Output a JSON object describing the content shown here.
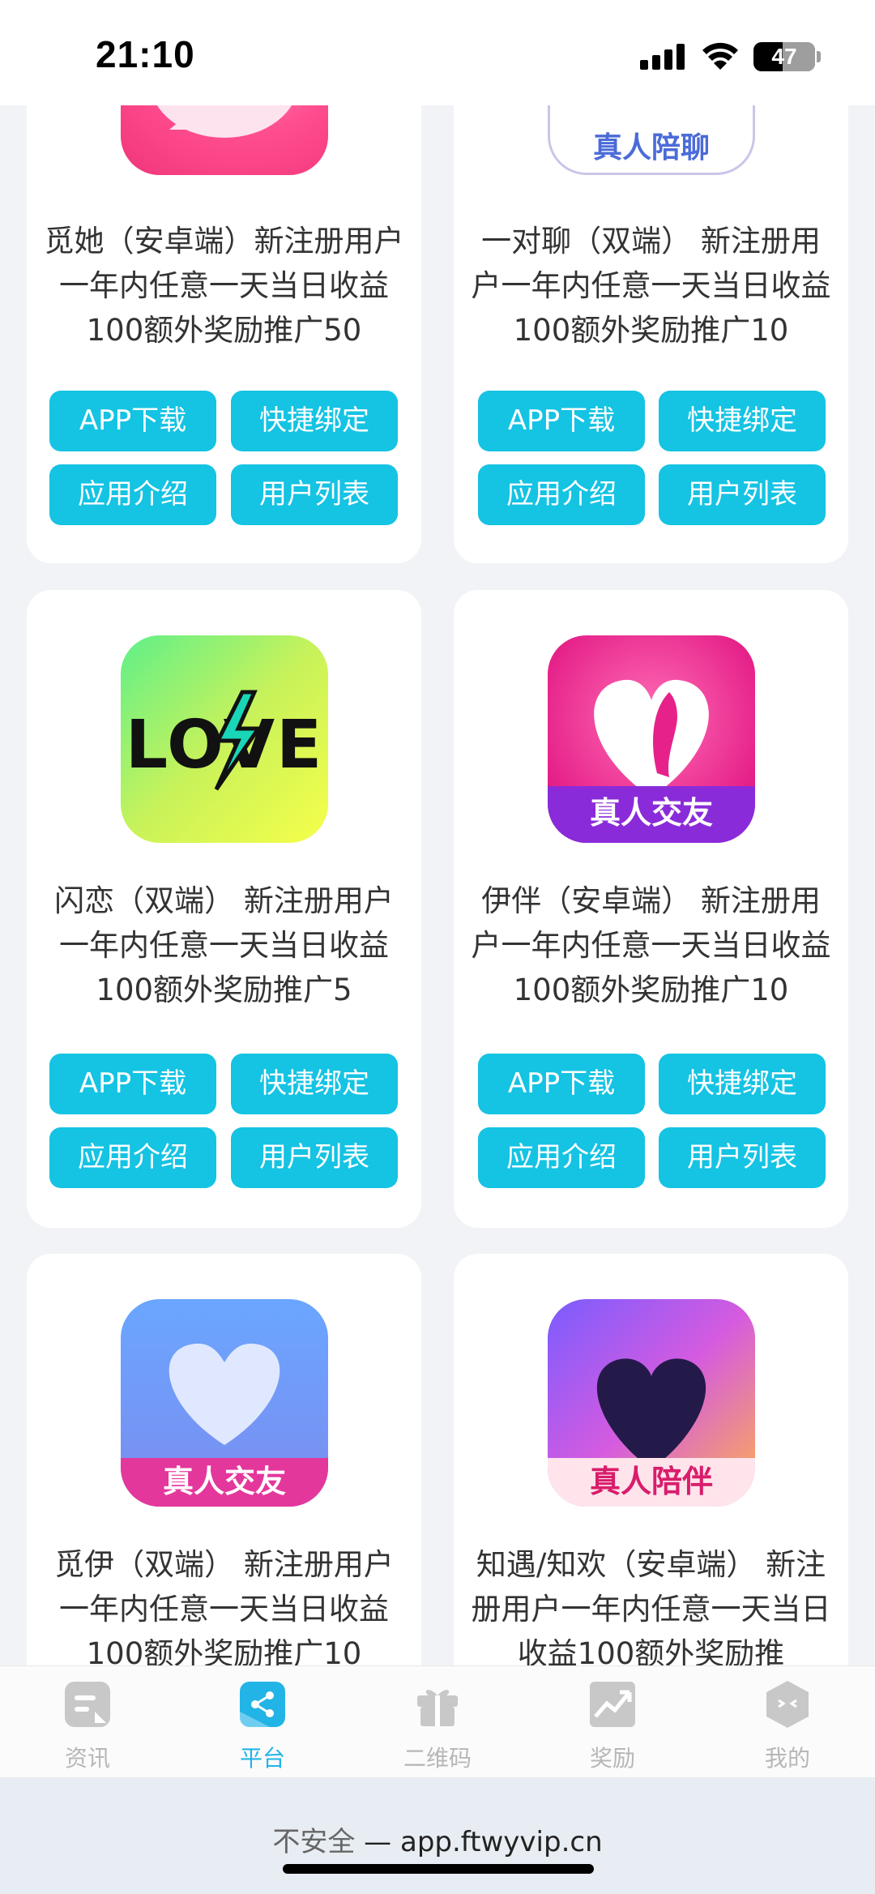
{
  "status": {
    "time": "21:10",
    "battery": "47",
    "battery_level": 0.47
  },
  "cards": [
    {
      "desc": "觅她（安卓端）新注册用户一年内任意一天当日收益100额外奖励推广50",
      "icon": "mita-app-icon"
    },
    {
      "desc": "一对聊（双端） 新注册用户一年内任意一天当日收益100额外奖励推广10",
      "icon": "yiduiliao-app-icon",
      "icon_label": "真人陪聊"
    },
    {
      "desc": "闪恋（双端） 新注册用户一年内任意一天当日收益100额外奖励推广5",
      "icon": "love-app-icon",
      "icon_text": "LOVE"
    },
    {
      "desc": "伊伴（安卓端） 新注册用户一年内任意一天当日收益100额外奖励推广10",
      "icon": "yiban-app-icon",
      "icon_label": "真人交友"
    },
    {
      "desc": "觅伊（双端） 新注册用户一年内任意一天当日收益100额外奖励推广10",
      "icon": "miyi-app-icon",
      "icon_label": "真人交友"
    },
    {
      "desc": "知遇/知欢（安卓端） 新注册用户一年内任意一天当日收益100额外奖励推",
      "icon": "zhiyu-app-icon",
      "icon_label": "真人陪伴"
    }
  ],
  "buttons": {
    "download": "APP下载",
    "bind": "快捷绑定",
    "intro": "应用介绍",
    "users": "用户列表"
  },
  "tabs": [
    {
      "label": "资讯",
      "icon": "news-icon"
    },
    {
      "label": "平台",
      "icon": "share-icon",
      "active": true
    },
    {
      "label": "二维码",
      "icon": "gift-icon"
    },
    {
      "label": "奖励",
      "icon": "chart-icon"
    },
    {
      "label": "我的",
      "icon": "profile-hex-icon"
    }
  ],
  "browser": {
    "insecure": "不安全",
    "separator": "—",
    "url": "app.ftwyvip.cn"
  },
  "colors": {
    "accent": "#15c3e3",
    "tab_active": "#22b4e6",
    "background": "#f2f3f6"
  }
}
